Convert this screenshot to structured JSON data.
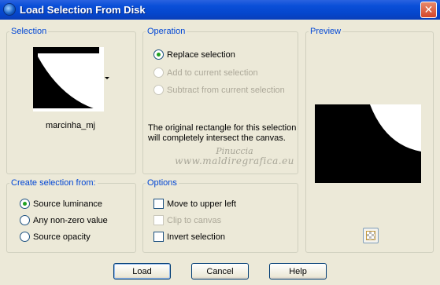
{
  "window": {
    "title": "Load Selection From Disk",
    "close_glyph": "✕",
    "icon": "app-globe-icon"
  },
  "selection_group": {
    "label": "Selection",
    "thumbnail_name": "marcinha_mj"
  },
  "operation_group": {
    "label": "Operation",
    "options": [
      {
        "label": "Replace selection",
        "checked": true,
        "enabled": true
      },
      {
        "label": "Add to current selection",
        "checked": false,
        "enabled": false
      },
      {
        "label": "Subtract from current selection",
        "checked": false,
        "enabled": false
      }
    ],
    "info": "The original rectangle for this selection will completely intersect the canvas."
  },
  "watermark": {
    "line1": "Pinuccia",
    "line2": "www.maldiregrafica.eu"
  },
  "preview_group": {
    "label": "Preview",
    "transparency_icon": "checkerboard-icon"
  },
  "create_group": {
    "label": "Create selection from:",
    "options": [
      {
        "label": "Source luminance",
        "checked": true
      },
      {
        "label": "Any non-zero value",
        "checked": false
      },
      {
        "label": "Source opacity",
        "checked": false
      }
    ]
  },
  "options_group": {
    "label": "Options",
    "items": [
      {
        "label": "Move to upper left",
        "checked": false,
        "enabled": true
      },
      {
        "label": "Clip to canvas",
        "checked": false,
        "enabled": false
      },
      {
        "label": "Invert selection",
        "checked": false,
        "enabled": true
      }
    ]
  },
  "buttons": {
    "load": "Load",
    "cancel": "Cancel",
    "help": "Help"
  },
  "colors": {
    "title_bar": "#0a4fd8",
    "dialog_bg": "#ece9d8",
    "group_label": "#0046d5",
    "radio_dot": "#21a121",
    "disabled_text": "#aca899"
  }
}
